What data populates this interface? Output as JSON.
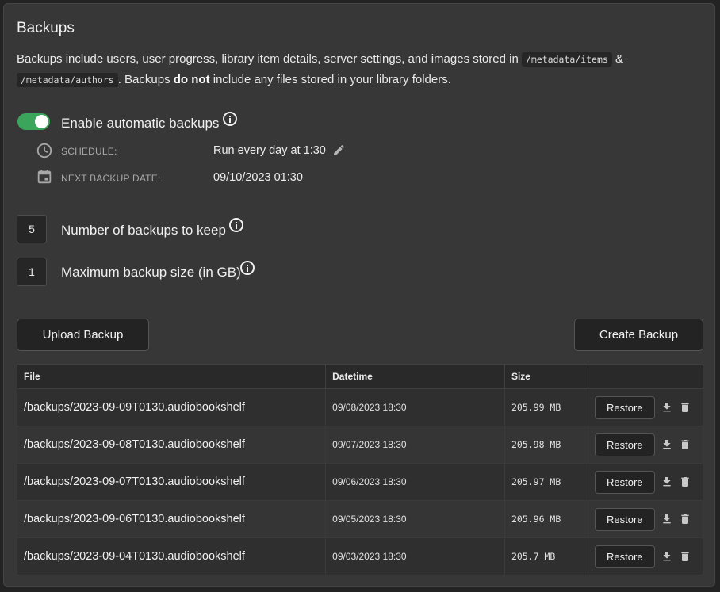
{
  "header": {
    "title": "Backups",
    "description_part1": "Backups include users, user progress, library item details, server settings, and images stored in ",
    "path_items": "/metadata/items",
    "description_part2": " & ",
    "path_authors": "/metadata/authors",
    "description_part3": ". Backups ",
    "description_bold": "do not",
    "description_part4": " include any files stored in your library folders."
  },
  "automatic": {
    "enabled": true,
    "label": "Enable automatic backups",
    "schedule_label": "SCHEDULE:",
    "schedule_value": "Run every day at 1:30",
    "next_label": "NEXT BACKUP DATE:",
    "next_value": "09/10/2023 01:30"
  },
  "settings": {
    "keep_value": "5",
    "keep_label": "Number of backups to keep",
    "size_value": "1",
    "size_label": "Maximum backup size (in GB)"
  },
  "actions": {
    "upload_label": "Upload Backup",
    "create_label": "Create Backup"
  },
  "table": {
    "headers": [
      "File",
      "Datetime",
      "Size",
      ""
    ],
    "restore_label": "Restore",
    "rows": [
      {
        "file": "/backups/2023-09-09T0130.audiobookshelf",
        "datetime": "09/08/2023 18:30",
        "size": "205.99 MB"
      },
      {
        "file": "/backups/2023-09-08T0130.audiobookshelf",
        "datetime": "09/07/2023 18:30",
        "size": "205.98 MB"
      },
      {
        "file": "/backups/2023-09-07T0130.audiobookshelf",
        "datetime": "09/06/2023 18:30",
        "size": "205.97 MB"
      },
      {
        "file": "/backups/2023-09-06T0130.audiobookshelf",
        "datetime": "09/05/2023 18:30",
        "size": "205.96 MB"
      },
      {
        "file": "/backups/2023-09-04T0130.audiobookshelf",
        "datetime": "09/03/2023 18:30",
        "size": "205.7 MB"
      }
    ]
  },
  "colors": {
    "toggle_on": "#3ba55c",
    "panel_bg": "#373737",
    "page_bg": "#232323"
  },
  "icons": {
    "info": "info-icon",
    "schedule": "clock-icon",
    "next_date": "calendar-icon",
    "edit": "pencil-icon",
    "download": "download-icon",
    "delete": "trash-icon"
  }
}
